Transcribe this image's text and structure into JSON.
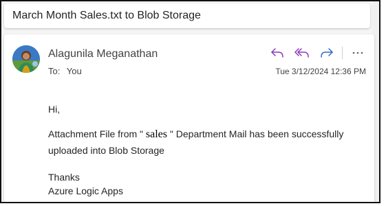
{
  "email": {
    "subject": "March Month Sales.txt to Blob Storage",
    "sender_name": "Alagunila Meganathan",
    "to_label": "To:",
    "to_value": "You",
    "timestamp": "Tue 3/12/2024 12:36 PM",
    "actions": [
      {
        "name": "reply",
        "icon": "reply-icon",
        "color": "#8a3ab9"
      },
      {
        "name": "reply-all",
        "icon": "reply-all-icon",
        "color": "#8a3ab9"
      },
      {
        "name": "forward",
        "icon": "forward-icon",
        "color": "#2b6cc4"
      },
      {
        "name": "more",
        "icon": "more-options-icon",
        "color": "#616161"
      }
    ],
    "body": {
      "greeting": "Hi,",
      "line1_prefix": "Attachment File from \" ",
      "department": "sales",
      "line1_suffix": " \" Department Mail has been successfully",
      "line2": "uploaded into Blob Storage",
      "closing": "Thanks",
      "signature": "Azure Logic Apps"
    }
  }
}
